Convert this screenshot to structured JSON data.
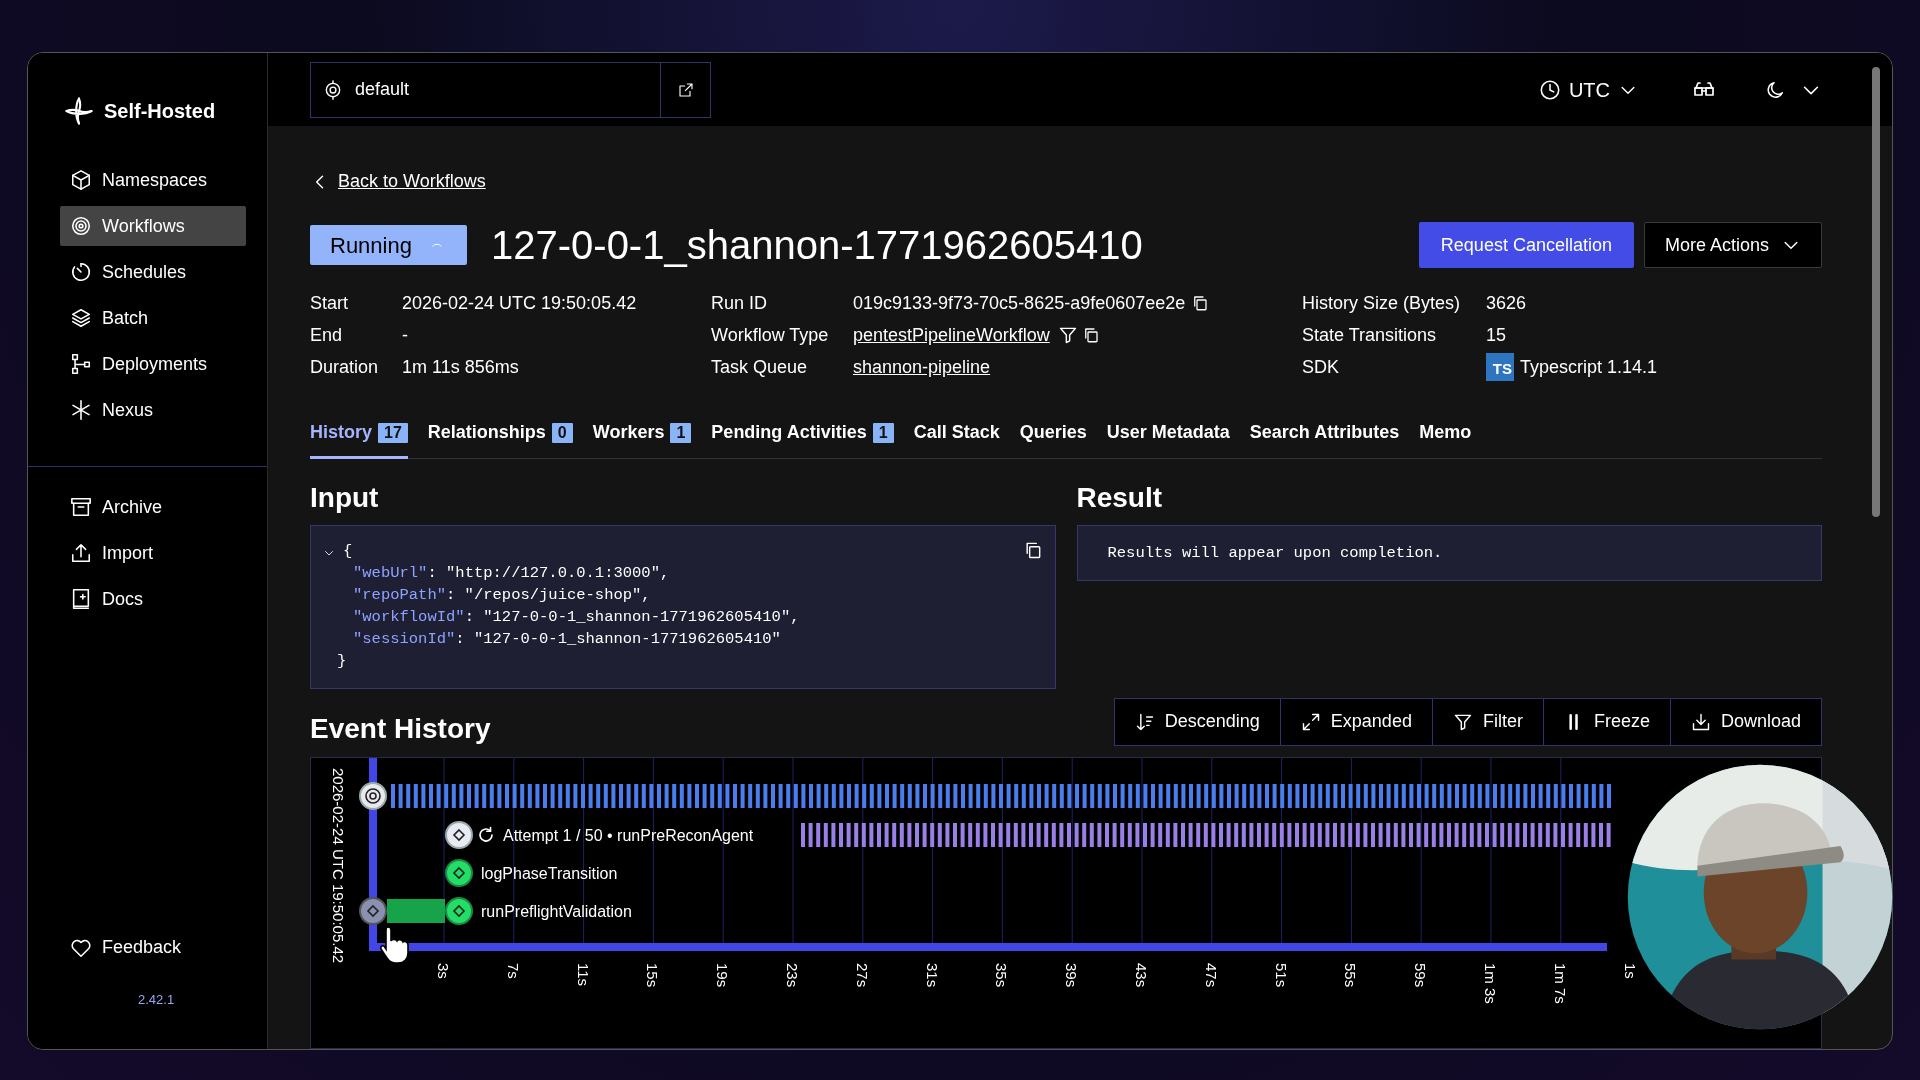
{
  "sidebar": {
    "brand": "Self-Hosted",
    "items": [
      {
        "label": "Namespaces",
        "selected": false
      },
      {
        "label": "Workflows",
        "selected": true
      },
      {
        "label": "Schedules",
        "selected": false
      },
      {
        "label": "Batch",
        "selected": false
      },
      {
        "label": "Deployments",
        "selected": false
      },
      {
        "label": "Nexus",
        "selected": false
      }
    ],
    "secondary_items": [
      {
        "label": "Archive"
      },
      {
        "label": "Import"
      },
      {
        "label": "Docs"
      }
    ],
    "feedback": "Feedback",
    "version": "2.42.1"
  },
  "top_bar": {
    "namespace": "default",
    "timezone": "UTC"
  },
  "back_link": "Back to Workflows",
  "workflow": {
    "status": "Running",
    "id": "127-0-0-1_shannon-1771962605410"
  },
  "actions": [
    {
      "label": "Request Cancellation",
      "kind": "primary"
    },
    {
      "label": "More Actions",
      "kind": "dropdown"
    }
  ],
  "details": [
    [
      {
        "label": "Start",
        "value": "2026-02-24 UTC 19:50:05.42",
        "kind": "text"
      },
      {
        "label": "End",
        "value": "-",
        "kind": "text"
      },
      {
        "label": "Duration",
        "value": "1m 11s 856ms",
        "kind": "text"
      }
    ],
    [
      {
        "label": "Run ID",
        "value": "019c9133-9f73-70c5-8625-a9fe0607ee2e",
        "kind": "copy"
      },
      {
        "label": "Workflow Type",
        "value": "pentestPipelineWorkflow",
        "kind": "link-filter"
      },
      {
        "label": "Task Queue",
        "value": "shannon-pipeline",
        "kind": "link"
      }
    ],
    [
      {
        "label": "History Size (Bytes)",
        "value": "3626",
        "kind": "text"
      },
      {
        "label": "State Transitions",
        "value": "15",
        "kind": "text"
      },
      {
        "label": "SDK",
        "value": "Typescript 1.14.1",
        "kind": "sdk",
        "badge": "TS"
      }
    ]
  ],
  "tabs": [
    {
      "label": "History",
      "count": "17",
      "selected": true
    },
    {
      "label": "Relationships",
      "count": "0",
      "selected": false
    },
    {
      "label": "Workers",
      "count": "1",
      "selected": false
    },
    {
      "label": "Pending Activities",
      "count": "1",
      "selected": false
    },
    {
      "label": "Call Stack",
      "selected": false
    },
    {
      "label": "Queries",
      "selected": false
    },
    {
      "label": "User Metadata",
      "selected": false
    },
    {
      "label": "Search Attributes",
      "selected": false
    },
    {
      "label": "Memo",
      "selected": false
    }
  ],
  "input": {
    "title": "Input",
    "open": "{",
    "close": "}",
    "lines": [
      {
        "key": "\"webUrl\"",
        "rest": ": \"http://127.0.0.1:3000\","
      },
      {
        "key": "\"repoPath\"",
        "rest": ": \"/repos/juice-shop\","
      },
      {
        "key": "\"workflowId\"",
        "rest": ": \"127-0-0-1_shannon-1771962605410\","
      },
      {
        "key": "\"sessionId\"",
        "rest": ": \"127-0-0-1_shannon-1771962605410\""
      }
    ]
  },
  "result": {
    "title": "Result",
    "message": "Results will appear upon completion."
  },
  "event_history": {
    "title": "Event History",
    "tools": [
      {
        "label": "Descending"
      },
      {
        "label": "Expanded"
      },
      {
        "label": "Filter"
      },
      {
        "label": "Freeze"
      },
      {
        "label": "Download"
      }
    ],
    "timeline": {
      "start_label": "2026-02-24 UTC 19:50:05.42",
      "events": [
        {
          "kind": "workflow"
        },
        {
          "kind": "pending",
          "label": "Attempt 1 / 50 • runPreReconAgent"
        },
        {
          "kind": "completed",
          "label": "logPhaseTransition"
        },
        {
          "kind": "completed-span",
          "label": "runPreflightValidation"
        }
      ],
      "ticks": [
        "3s",
        "7s",
        "11s",
        "15s",
        "19s",
        "23s",
        "27s",
        "31s",
        "35s",
        "39s",
        "43s",
        "47s",
        "51s",
        "55s",
        "59s",
        "1m 3s",
        "1m 7s",
        "1s"
      ]
    }
  }
}
